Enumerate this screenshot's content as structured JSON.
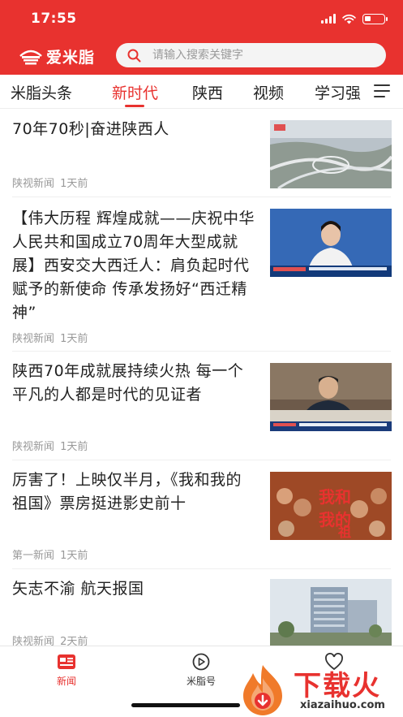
{
  "status_bar": {
    "time": "17:55"
  },
  "header": {
    "logo_text": "爱米脂",
    "search_placeholder": "请输入搜索关键字"
  },
  "tabs": [
    {
      "label": "米脂头条",
      "active": false
    },
    {
      "label": "新时代",
      "active": true
    },
    {
      "label": "陕西",
      "active": false
    },
    {
      "label": "视频",
      "active": false
    },
    {
      "label": "学习强",
      "active": false
    }
  ],
  "feed": [
    {
      "title": "70年70秒|奋进陕西人",
      "source": "陕视新闻",
      "time": "1天前",
      "thumb": "aerial-highway-interchange"
    },
    {
      "title": "【伟大历程 辉煌成就——庆祝中华人民共和国成立70周年大型成就展】西安交大西迁人：肩负起时代赋予的新使命 传承发扬好“西迁精神”",
      "source": "陕视新闻",
      "time": "1天前",
      "thumb": "news-anchor-studio"
    },
    {
      "title": "陕西70年成就展持续火热 每一个平凡的人都是时代的见证者",
      "source": "陕视新闻",
      "time": "1天前",
      "thumb": "official-speaking-at-meeting"
    },
    {
      "title": "厉害了！上映仅半月，《我和我的祖国》票房挺进影史前十",
      "source": "第一新闻",
      "time": "1天前",
      "thumb": "movie-poster-my-people-my-country"
    },
    {
      "title": "矢志不渝 航天报国",
      "source": "陕视新闻",
      "time": "2天前",
      "thumb": "office-building-campus"
    }
  ],
  "bottom_nav": [
    {
      "label": "新闻",
      "icon": "news-icon",
      "active": true
    },
    {
      "label": "米脂号",
      "icon": "play-circle-icon",
      "active": false
    },
    {
      "label": "",
      "icon": "heart-icon",
      "active": false
    }
  ],
  "watermark": {
    "text": "下载火",
    "url": "xiazaihuo.com"
  },
  "colors": {
    "brand": "#e8322f",
    "text": "#222222",
    "meta": "#999999"
  }
}
